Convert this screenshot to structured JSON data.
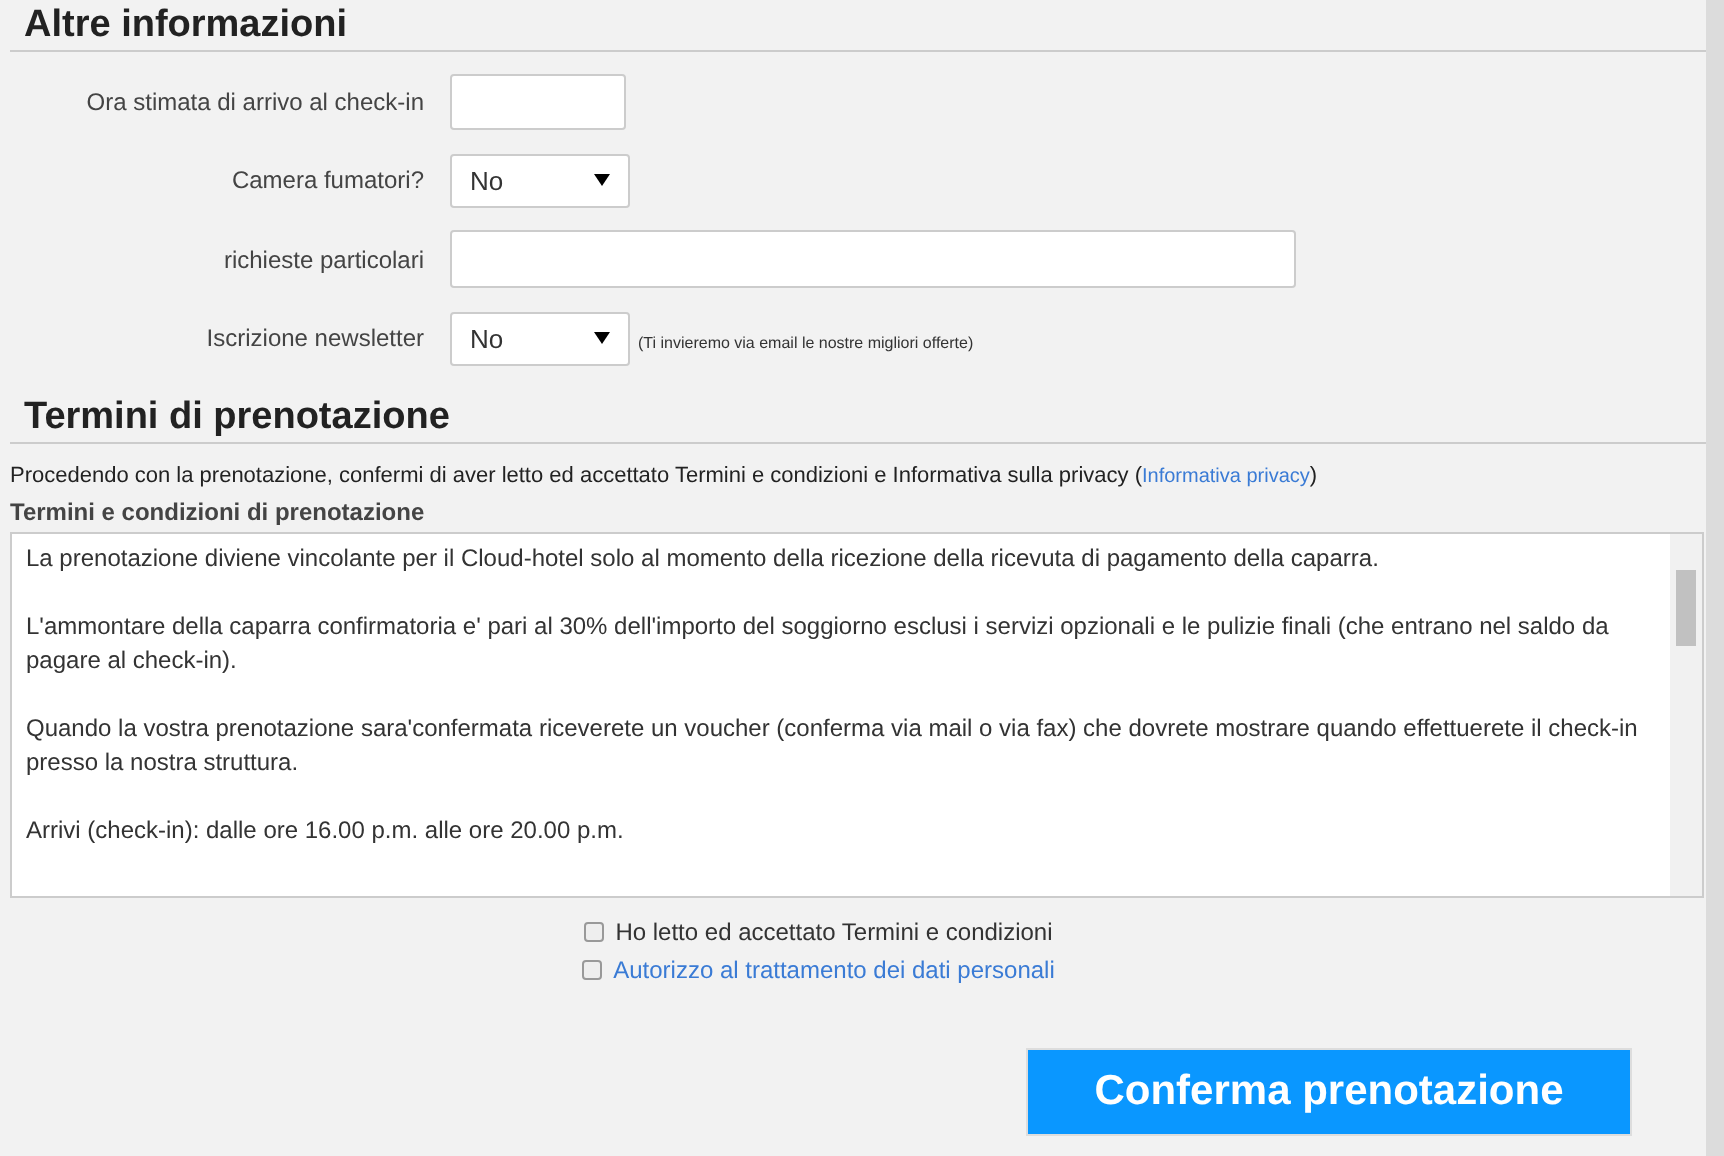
{
  "extra_info": {
    "title": "Altre informazioni",
    "fields": [
      {
        "label": "Ora stimata di arrivo al check-in",
        "kind": "short"
      },
      {
        "label": "Camera fumatori?",
        "kind": "select",
        "value": "No"
      },
      {
        "label": "richieste particolari",
        "kind": "long"
      },
      {
        "label": "Iscrizione newsletter",
        "kind": "select",
        "value": "No",
        "note": "(Ti invieremo via email le nostre migliori offerte)"
      }
    ]
  },
  "terms": {
    "title": "Termini di prenotazione",
    "intro": "Procedendo con la prenotazione, confermi di aver letto ed accettato Termini e condizioni e Informativa sulla privacy (",
    "intro_link": "Informativa privacy",
    "intro_end": ")",
    "box_title": "Termini e condizioni di prenotazione",
    "paragraphs": [
      "La prenotazione diviene vincolante per il Cloud-hotel solo al momento della ricezione della ricevuta di pagamento della caparra.",
      "L'ammontare della caparra confirmatoria e' pari al 30% dell'importo del soggiorno esclusi i servizi opzionali e le pulizie finali (che entrano nel saldo da pagare al check-in).",
      "Quando la vostra prenotazione sara'confermata riceverete un voucher (conferma via mail o via fax) che dovrete mostrare quando effettuerete il check-in presso la nostra struttura.",
      "Arrivi (check-in): dalle ore 16.00 p.m. alle ore 20.00 p.m."
    ],
    "checkboxes": [
      {
        "label": "Ho letto ed accettato Termini e condizioni",
        "kind": "plain",
        "checked": false
      },
      {
        "label": "Autorizzo al trattamento dei dati personali",
        "kind": "link",
        "checked": false
      }
    ]
  },
  "submit": "Conferma prenotazione"
}
